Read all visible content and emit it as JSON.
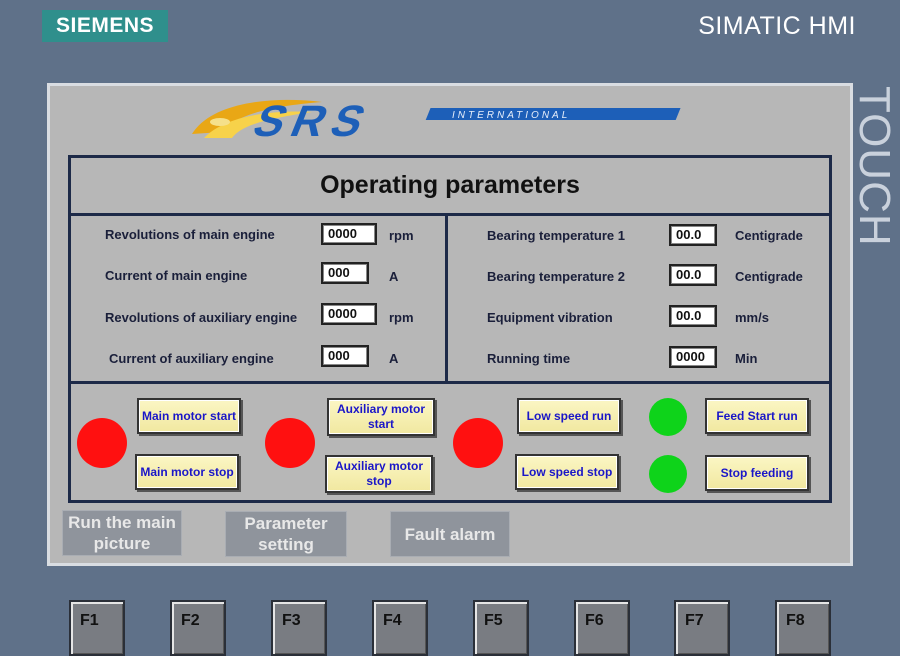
{
  "device": {
    "brand": "SIEMENS",
    "model": "SIMATIC HMI",
    "touch_label": "TOUCH"
  },
  "logo": {
    "text": "SRS",
    "subtext": "INTERNATIONAL"
  },
  "title": "Operating parameters",
  "params_left": [
    {
      "label": "Revolutions of main engine",
      "value": "0000",
      "unit": "rpm"
    },
    {
      "label": "Current  of main engine",
      "value": "000",
      "unit": "A"
    },
    {
      "label": "Revolutions of auxiliary engine",
      "value": "0000",
      "unit": "rpm"
    },
    {
      "label": "Current  of auxiliary engine",
      "value": "000",
      "unit": "A"
    }
  ],
  "params_right": [
    {
      "label": "Bearing temperature 1",
      "value": "00.0",
      "unit": "Centigrade"
    },
    {
      "label": "Bearing temperature 2",
      "value": "00.0",
      "unit": "Centigrade"
    },
    {
      "label": "Equipment vibration",
      "value": "00.0",
      "unit": "mm/s"
    },
    {
      "label": "Running time",
      "value": "0000",
      "unit": "Min"
    }
  ],
  "controls": {
    "main_start": "Main motor start",
    "main_stop": "Main motor stop",
    "aux_start": "Auxiliary motor start",
    "aux_stop": "Auxiliary motor stop",
    "low_start": "Low speed run",
    "low_stop": "Low speed stop",
    "feed_start": "Feed Start run",
    "feed_stop": "Stop feeding"
  },
  "lamp_states": {
    "main_motor": "off-red",
    "aux_motor": "off-red",
    "low_speed": "off-red",
    "feed_start": "on-green",
    "feed_stop": "on-green"
  },
  "colors": {
    "lamp_red": "#ff1010",
    "lamp_green": "#0ed31a",
    "button_text": "#1a16c8",
    "screen_bg": "#b7b7b7",
    "bezel": "#5f7189"
  },
  "nav": {
    "run_main": "Run the main picture",
    "param_setting": "Parameter setting",
    "fault_alarm": "Fault alarm"
  },
  "fkeys": [
    "F1",
    "F2",
    "F3",
    "F4",
    "F5",
    "F6",
    "F7",
    "F8"
  ]
}
